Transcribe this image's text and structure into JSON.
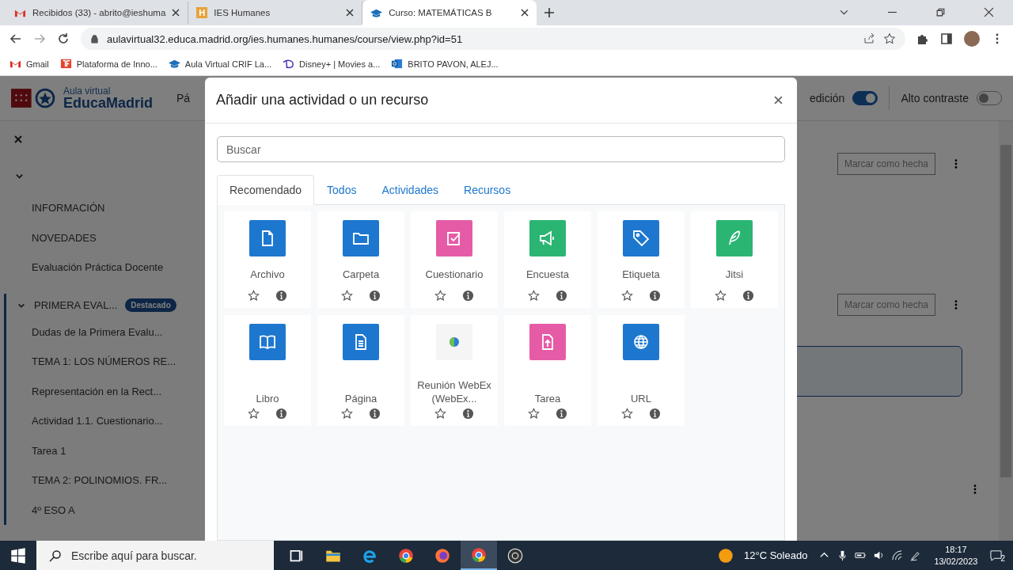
{
  "browser": {
    "tabs": [
      {
        "title": "Recibidos (33) - abrito@ieshuma",
        "selected": false
      },
      {
        "title": "IES Humanes",
        "letter": "H",
        "selected": false
      },
      {
        "title": "Curso: MATEMÁTICAS B",
        "selected": true
      }
    ],
    "address": "aulavirtual32.educa.madrid.org/ies.humanes.humanes/course/view.php?id=51",
    "bookmarks": [
      {
        "label": "Gmail"
      },
      {
        "label": "Plataforma de Inno..."
      },
      {
        "label": "Aula Virtual CRIF La..."
      },
      {
        "label": "Disney+ | Movies a..."
      },
      {
        "label": "BRITO PAVON, ALEJ..."
      }
    ]
  },
  "header": {
    "logo_small": "Aula virtual",
    "logo_big": "EducaMadrid",
    "nav_cut": "Pá",
    "toggles": [
      {
        "label": "edición",
        "on": true
      },
      {
        "label": "Alto contraste",
        "on": false
      }
    ]
  },
  "sidebar": {
    "items": [
      {
        "label": "INFORMACIÓN"
      },
      {
        "label": "NOVEDADES"
      },
      {
        "label": "Evaluación Práctica Docente"
      }
    ],
    "section": {
      "label": "PRIMERA EVAL...",
      "badge": "Destacado",
      "expanded": true,
      "children": [
        {
          "label": "Dudas de la Primera Evalu..."
        },
        {
          "label": "TEMA 1: LOS NÚMEROS RE..."
        },
        {
          "label": "Representación en la Rect..."
        },
        {
          "label": "Actividad 1.1. Cuestionario..."
        },
        {
          "label": "Tarea 1"
        },
        {
          "label": "TEMA 2: POLINOMIOS. FR..."
        },
        {
          "label": "4º ESO A"
        }
      ]
    }
  },
  "content": {
    "buttons": [
      "Marcar como hecha",
      "Marcar como hecha"
    ]
  },
  "modal": {
    "title": "Añadir una actividad o un recurso",
    "search": {
      "placeholder": "Buscar"
    },
    "tabs": [
      {
        "label": "Recomendado",
        "selected": true
      },
      {
        "label": "Todos",
        "selected": false
      },
      {
        "label": "Actividades",
        "selected": false
      },
      {
        "label": "Recursos",
        "selected": false
      }
    ],
    "items": [
      {
        "name": "Archivo",
        "kind": "file",
        "color": "#1d77cf"
      },
      {
        "name": "Carpeta",
        "kind": "folder",
        "color": "#1d77cf"
      },
      {
        "name": "Cuestionario",
        "kind": "quiz",
        "color": "#e55ba6"
      },
      {
        "name": "Encuesta",
        "kind": "megaphone",
        "color": "#2bb573"
      },
      {
        "name": "Etiqueta",
        "kind": "tag",
        "color": "#1d77cf"
      },
      {
        "name": "Jitsi",
        "kind": "feather",
        "color": "#2bb573"
      },
      {
        "name": "Libro",
        "kind": "book",
        "color": "#1d77cf"
      },
      {
        "name": "Página",
        "kind": "page",
        "color": "#1d77cf"
      },
      {
        "name": "Reunión WebEx (WebEx...",
        "kind": "globe-ball"
      },
      {
        "name": "Tarea",
        "kind": "upload",
        "color": "#e55ba6"
      },
      {
        "name": "URL",
        "kind": "globe",
        "color": "#1d77cf"
      }
    ]
  },
  "taskbar": {
    "search_placeholder": "Escribe aquí para buscar.",
    "weather": "12°C Soleado",
    "time": "18:17",
    "date": "13/02/2023",
    "notifications": "2"
  }
}
